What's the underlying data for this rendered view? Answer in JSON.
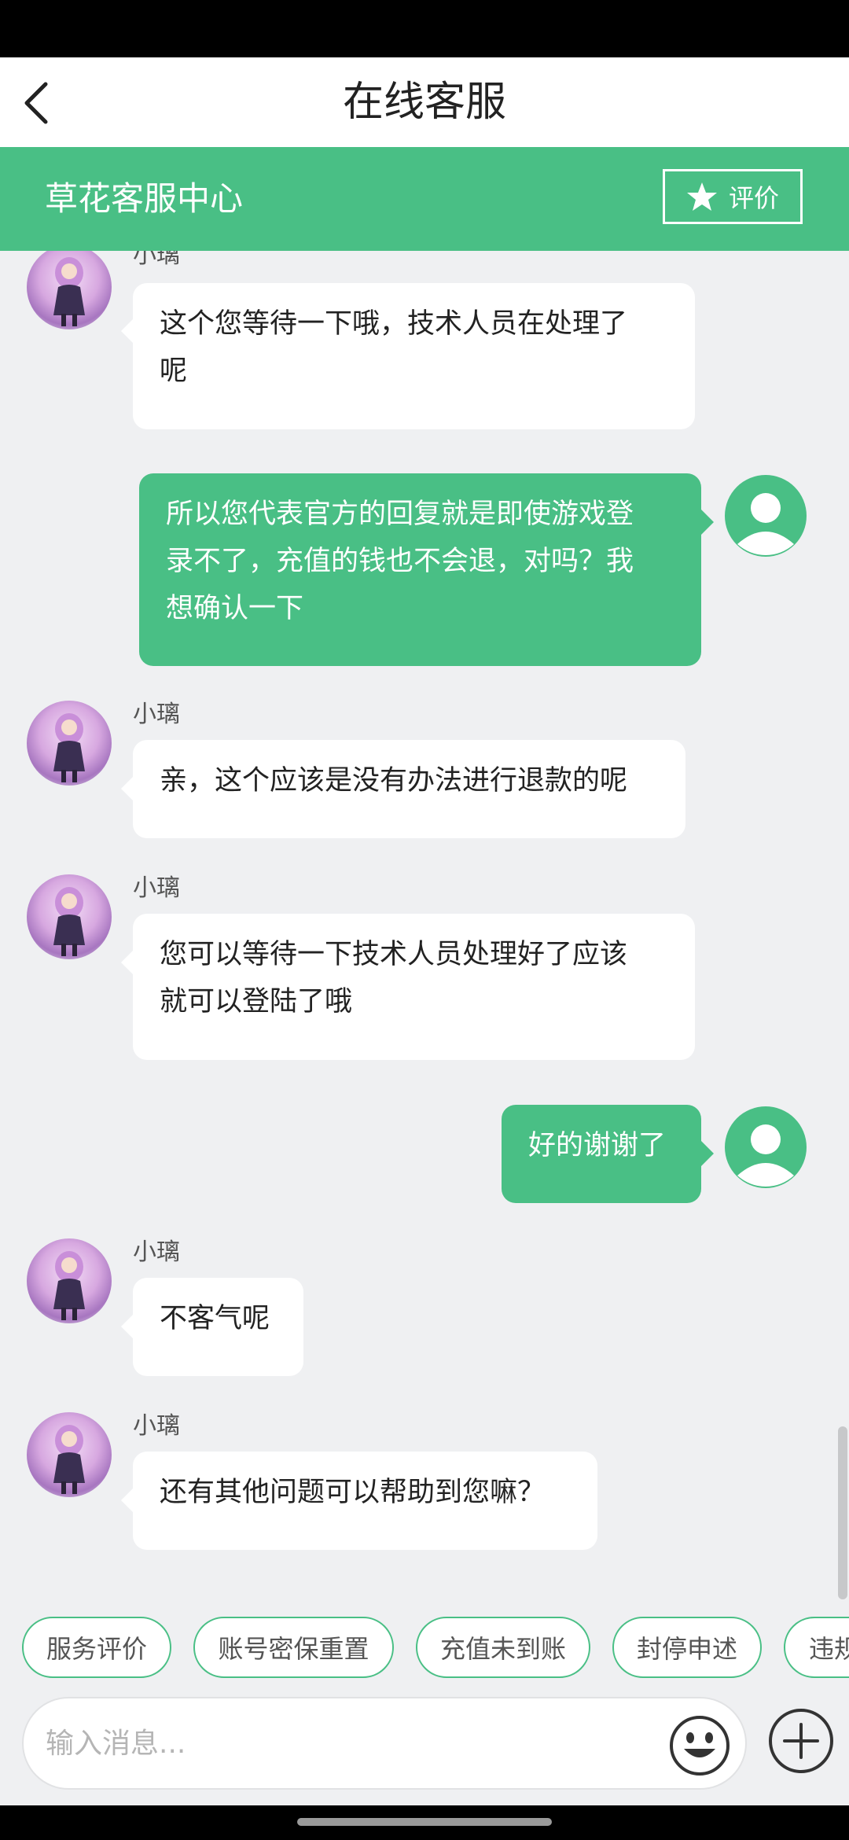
{
  "nav": {
    "title": "在线客服"
  },
  "header": {
    "title": "草花客服中心",
    "rate_label": "评价"
  },
  "agent_name": "小璃",
  "messages": [
    {
      "from": "agent",
      "name": "小璃",
      "text_lines": [
        "这个您等待一下哦，技术人员在处理了",
        "呢"
      ]
    },
    {
      "from": "user",
      "text_lines": [
        "所以您代表官方的回复就是即使游戏登",
        "录不了，充值的钱也不会退，对吗？我",
        "想确认一下"
      ]
    },
    {
      "from": "agent",
      "name": "小璃",
      "text_lines": [
        "亲，这个应该是没有办法进行退款的呢"
      ]
    },
    {
      "from": "agent",
      "name": "小璃",
      "text_lines": [
        "您可以等待一下技术人员处理好了应该",
        "就可以登陆了哦"
      ]
    },
    {
      "from": "user",
      "text_lines": [
        "好的谢谢了"
      ]
    },
    {
      "from": "agent",
      "name": "小璃",
      "text_lines": [
        "不客气呢"
      ]
    },
    {
      "from": "agent",
      "name": "小璃",
      "text_lines": [
        "还有其他问题可以帮助到您嘛？"
      ]
    }
  ],
  "quick_replies": [
    "服务评价",
    "账号密保重置",
    "充值未到账",
    "封停申述",
    "违规"
  ],
  "input": {
    "placeholder": "输入消息..."
  },
  "colors": {
    "accent": "#49bf85",
    "background": "#eff0f2"
  },
  "icons": {
    "back": "chevron-left-icon",
    "star": "star-icon",
    "emoji": "smiley-icon",
    "plus": "plus-circle-icon",
    "avatar_user": "user-avatar-icon"
  }
}
